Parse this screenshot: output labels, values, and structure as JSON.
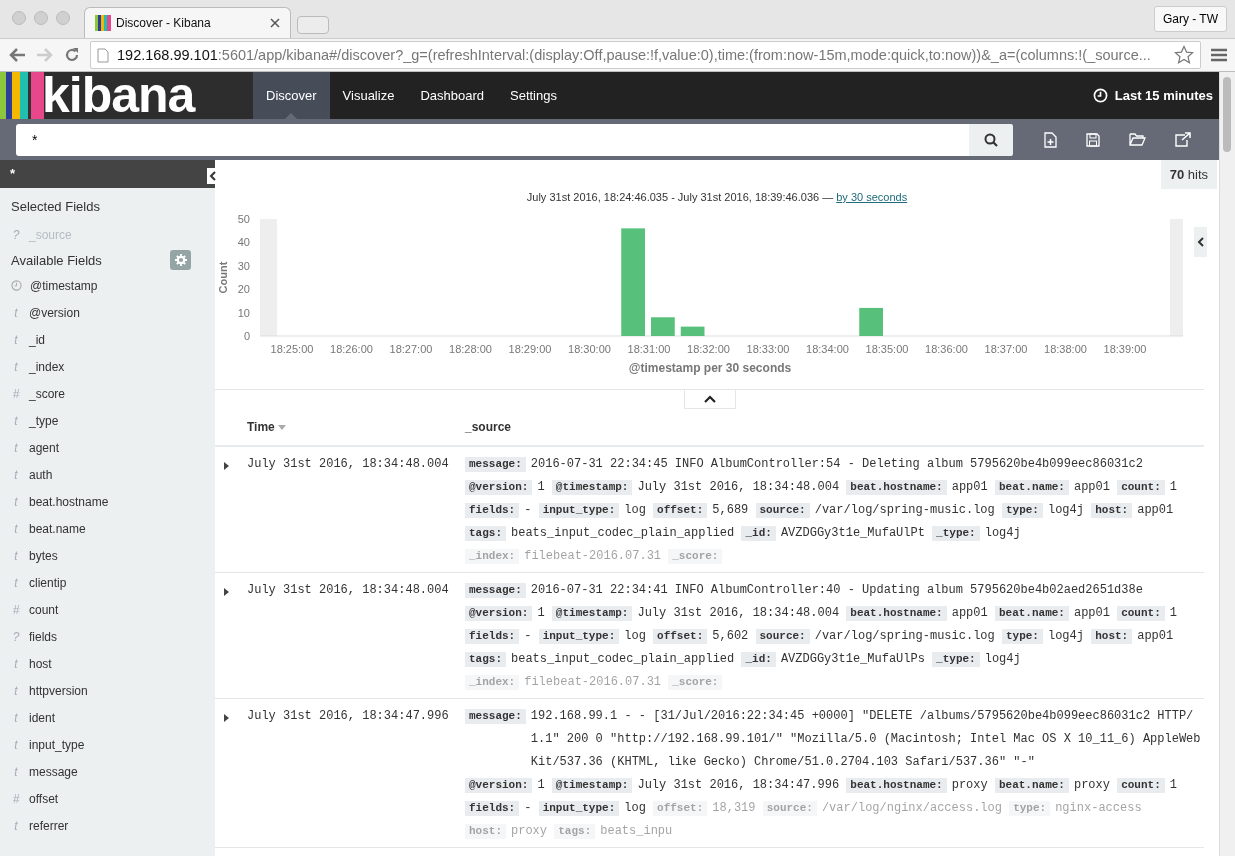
{
  "browser": {
    "tab_title": "Discover - Kibana",
    "profile": "Gary - TW",
    "url_host": "192.168.99.101",
    "url_rest": ":5601/app/kibana#/discover?_g=(refreshInterval:(display:Off,pause:!f,value:0),time:(from:now-15m,mode:quick,to:now))&_a=(columns:!(_source..."
  },
  "app": {
    "logo": "kibana",
    "nav": [
      {
        "label": "Discover",
        "selected": true
      },
      {
        "label": "Visualize",
        "selected": false
      },
      {
        "label": "Dashboard",
        "selected": false
      },
      {
        "label": "Settings",
        "selected": false
      }
    ],
    "time_picker": "Last 15 minutes"
  },
  "search": {
    "value": "*"
  },
  "sidebar": {
    "index_pattern": "*",
    "selected_heading": "Selected Fields",
    "selected_fields": [
      {
        "symbol": "?",
        "name": "_source"
      }
    ],
    "available_heading": "Available Fields",
    "available_fields": [
      {
        "name": "@timestamp"
      },
      {
        "symbol": "t",
        "name": "@version"
      },
      {
        "symbol": "t",
        "name": "_id"
      },
      {
        "symbol": "t",
        "name": "_index"
      },
      {
        "symbol": "#",
        "name": "_score"
      },
      {
        "symbol": "t",
        "name": "_type"
      },
      {
        "symbol": "t",
        "name": "agent"
      },
      {
        "symbol": "t",
        "name": "auth"
      },
      {
        "symbol": "t",
        "name": "beat.hostname"
      },
      {
        "symbol": "t",
        "name": "beat.name"
      },
      {
        "symbol": "t",
        "name": "bytes"
      },
      {
        "symbol": "t",
        "name": "clientip"
      },
      {
        "symbol": "#",
        "name": "count"
      },
      {
        "symbol": "?",
        "name": "fields"
      },
      {
        "symbol": "t",
        "name": "host"
      },
      {
        "symbol": "t",
        "name": "httpversion"
      },
      {
        "symbol": "t",
        "name": "ident"
      },
      {
        "symbol": "t",
        "name": "input_type"
      },
      {
        "symbol": "t",
        "name": "message"
      },
      {
        "symbol": "#",
        "name": "offset"
      },
      {
        "symbol": "t",
        "name": "referrer"
      }
    ]
  },
  "hits": {
    "count": "70",
    "label": "hits"
  },
  "histogram": {
    "range": "July 31st 2016, 18:24:46.035 - July 31st 2016, 18:39:46.036 —",
    "interval_link": "by 30 seconds",
    "chart_data": {
      "type": "bar",
      "xlabel": "@timestamp per 30 seconds",
      "ylabel": "Count",
      "ylim": [
        0,
        50
      ],
      "yticks": [
        0,
        10,
        20,
        30,
        40,
        50
      ],
      "categories": [
        null,
        "18:25:00",
        null,
        "18:26:00",
        null,
        "18:27:00",
        null,
        "18:28:00",
        null,
        "18:29:00",
        null,
        "18:30:00",
        null,
        "18:31:00",
        null,
        "18:32:00",
        null,
        "18:33:00",
        null,
        "18:34:00",
        null,
        "18:35:00",
        null,
        "18:36:00",
        null,
        "18:37:00",
        null,
        "18:38:00",
        null,
        "18:39:00",
        null
      ],
      "series": [
        {
          "color": "#57c17b",
          "values": [
            0,
            0,
            0,
            0,
            0,
            0,
            0,
            0,
            0,
            0,
            0,
            0,
            46,
            8,
            4,
            0,
            0,
            0,
            0,
            0,
            12,
            0,
            0,
            0,
            0,
            0,
            0,
            0,
            0,
            0,
            0
          ]
        }
      ]
    }
  },
  "table": {
    "columns": [
      "Time",
      "_source"
    ],
    "rows": [
      {
        "time": "July 31st 2016, 18:34:48.004",
        "fields": [
          {
            "key": "message:",
            "value": "2016-07-31 22:34:45 INFO AlbumController:54 - Deleting album 5795620be4b099eec86031c2",
            "faded": false
          },
          {
            "key": "@version:",
            "value": "1",
            "faded": false
          },
          {
            "key": "@timestamp:",
            "value": "July 31st 2016, 18:34:48.004",
            "faded": false
          },
          {
            "key": "beat.hostname:",
            "value": "app01",
            "faded": false
          },
          {
            "key": "beat.name:",
            "value": "app01",
            "faded": false
          },
          {
            "key": "count:",
            "value": "1",
            "faded": false
          },
          {
            "key": "fields:",
            "value": " -",
            "faded": false
          },
          {
            "key": "input_type:",
            "value": "log",
            "faded": false
          },
          {
            "key": "offset:",
            "value": "5,689",
            "faded": false
          },
          {
            "key": "source:",
            "value": "/var/log/spring-music.log",
            "faded": false
          },
          {
            "key": "type:",
            "value": "log4j",
            "faded": false
          },
          {
            "key": "host:",
            "value": "app01",
            "faded": false
          },
          {
            "key": "tags:",
            "value": "beats_input_codec_plain_applied",
            "faded": false
          },
          {
            "key": "_id:",
            "value": "AVZDGGy3t1e_MufaUlPt",
            "faded": false
          },
          {
            "key": "_type:",
            "value": "log4j",
            "faded": false
          },
          {
            "key": "_index:",
            "value": "filebeat-2016.07.31",
            "faded": true
          },
          {
            "key": "_score:",
            "faded": true
          }
        ]
      },
      {
        "time": "July 31st 2016, 18:34:48.004",
        "fields": [
          {
            "key": "message:",
            "value": "2016-07-31 22:34:41 INFO AlbumController:40 - Updating album 5795620be4b02aed2651d38e",
            "faded": false
          },
          {
            "key": "@version:",
            "value": "1",
            "faded": false
          },
          {
            "key": "@timestamp:",
            "value": "July 31st 2016, 18:34:48.004",
            "faded": false
          },
          {
            "key": "beat.hostname:",
            "value": "app01",
            "faded": false
          },
          {
            "key": "beat.name:",
            "value": "app01",
            "faded": false
          },
          {
            "key": "count:",
            "value": "1",
            "faded": false
          },
          {
            "key": "fields:",
            "value": " -",
            "faded": false
          },
          {
            "key": "input_type:",
            "value": "log",
            "faded": false
          },
          {
            "key": "offset:",
            "value": "5,602",
            "faded": false
          },
          {
            "key": "source:",
            "value": "/var/log/spring-music.log",
            "faded": false
          },
          {
            "key": "type:",
            "value": "log4j",
            "faded": false
          },
          {
            "key": "host:",
            "value": "app01",
            "faded": false
          },
          {
            "key": "tags:",
            "value": "beats_input_codec_plain_applied",
            "faded": false
          },
          {
            "key": "_id:",
            "value": "AVZDGGy3t1e_MufaUlPs",
            "faded": false
          },
          {
            "key": "_type:",
            "value": "log4j",
            "faded": false
          },
          {
            "key": "_index:",
            "value": "filebeat-2016.07.31",
            "faded": true
          },
          {
            "key": "_score:",
            "faded": true
          }
        ]
      },
      {
        "time": "July 31st 2016, 18:34:47.996",
        "fields": [
          {
            "key": "message:",
            "value": "192.168.99.1 - - [31/Jul/2016:22:34:45 +0000] \"DELETE /albums/5795620be4b099eec86031c2 HTTP/1.1\" 200 0 \"http://192.168.99.101/\" \"Mozilla/5.0 (Macintosh; Intel Mac OS X 10_11_6) AppleWebKit/537.36 (KHTML, like Gecko) Chrome/51.0.2704.103 Safari/537.36\" \"-\"",
            "faded": false
          },
          {
            "key": "@version:",
            "value": "1",
            "faded": false
          },
          {
            "key": "@timestamp:",
            "value": "July 31st 2016, 18:34:47.996",
            "faded": false
          },
          {
            "key": "beat.hostname:",
            "value": "proxy",
            "faded": false
          },
          {
            "key": "beat.name:",
            "value": "proxy",
            "faded": false
          },
          {
            "key": "count:",
            "value": "1",
            "faded": false
          },
          {
            "key": "fields:",
            "value": " -",
            "faded": false
          },
          {
            "key": "input_type:",
            "value": "log",
            "faded": false
          },
          {
            "key": "offset:",
            "value": "18,319",
            "faded": true
          },
          {
            "key": "source:",
            "value": "/var/log/nginx/access.log",
            "faded": true
          },
          {
            "key": "type:",
            "value": "nginx-access",
            "faded": true
          },
          {
            "key": "host:",
            "value": "proxy",
            "faded": true
          },
          {
            "key": "tags:",
            "value": "beats_inpu",
            "faded": true
          }
        ]
      }
    ]
  }
}
